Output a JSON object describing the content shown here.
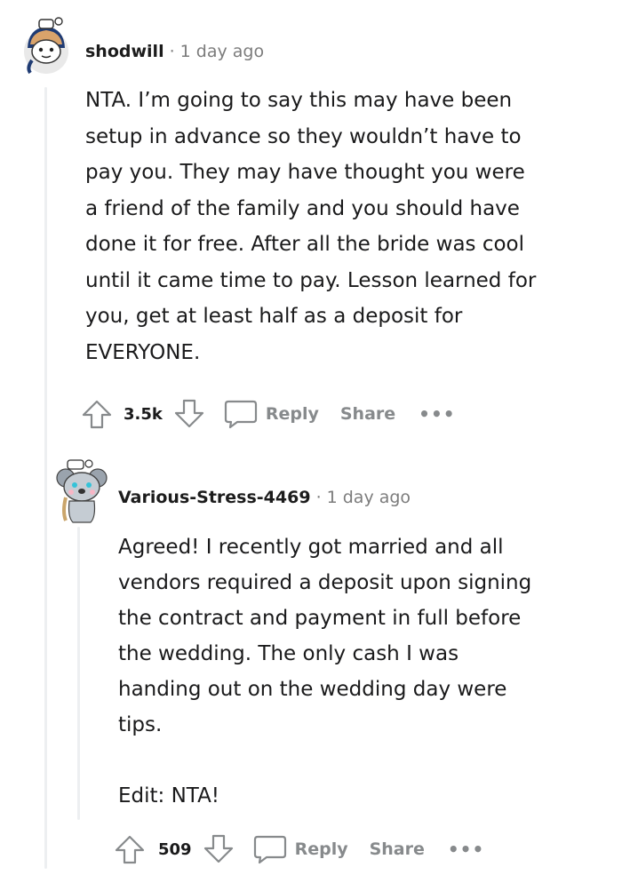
{
  "comments": [
    {
      "author": "shodwill",
      "separator": "·",
      "time": "1 day ago",
      "avatar_icon": "snoo-avatar-hat-icon",
      "body": "NTA. I’m going to say this may have been\nsetup in advance so they wouldn’t have to\npay you. They may have thought you were\na friend of the family and you should have\ndone it for free. After all the bride was cool\nuntil it came time to pay. Lesson learned for\nyou, get at least half as a deposit for\nEVERYONE.",
      "score": "3.5k",
      "reply_label": "Reply",
      "share_label": "Share",
      "more_label": "•••"
    },
    {
      "author": "Various-Stress-4469",
      "separator": "·",
      "time": "1 day ago",
      "avatar_icon": "snoo-avatar-koala-icon",
      "body": "Agreed! I recently got married and all\nvendors required a deposit upon signing\nthe contract and payment in full before\nthe wedding. The only cash I was\nhanding out on the wedding day were\ntips.\n\nEdit: NTA!",
      "score": "509",
      "reply_label": "Reply",
      "share_label": "Share",
      "more_label": "•••"
    }
  ],
  "colors": {
    "meta_gray": "#7c7c7c",
    "action_gray": "#878a8c",
    "thread_line": "#edeff1",
    "text": "#1a1a1b"
  }
}
